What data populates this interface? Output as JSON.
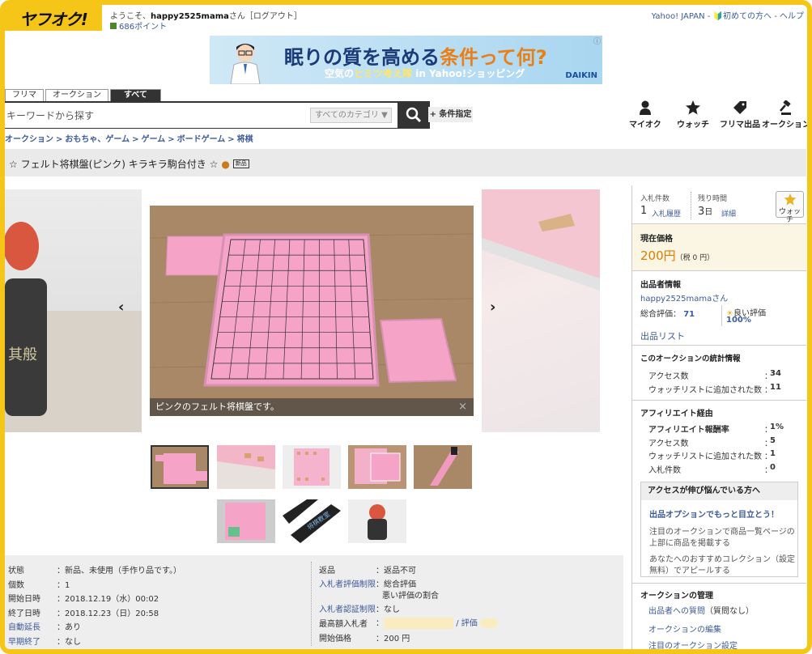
{
  "header": {
    "logo": "ヤフオク!",
    "welcome_prefix": "ようこそ、",
    "username": "happy2525mama",
    "welcome_suffix": "さん［ログアウト］",
    "points": "686ポイント",
    "toplinks": "Yahoo! JAPAN - 🔰初めての方へ - ヘルプ"
  },
  "ad": {
    "line1_a": "眠りの質を高める",
    "line1_b": "条件って何?",
    "line2_a": "空気の",
    "line2_b": "ヒミツ考え隊",
    "line2_c": " in Yahoo!ショッピング",
    "brand": "DAIKIN",
    "info": "ⓘ"
  },
  "search": {
    "tabs": [
      "フリマ",
      "オークション",
      "すべて"
    ],
    "placeholder": "キーワードから探す",
    "category": "すべてのカテゴリ",
    "conditions": "+ 条件指定"
  },
  "nav": {
    "myauc": "マイオク",
    "watch": "ウォッチ",
    "flea_sell": "フリマ出品",
    "auc_sell": "オークション"
  },
  "breadcrumb": [
    "オークション",
    "おもちゃ、ゲーム",
    "ゲーム",
    "ボードゲーム",
    "将棋"
  ],
  "item": {
    "title": "☆ フェルト将棋盤(ピンク) キラキラ駒台付き ☆",
    "badge": "新品",
    "caption": "ピンクのフェルト将棋盤です。",
    "close": "×"
  },
  "details_left": [
    {
      "label": "状態",
      "value": "：新品、未使用（手作り品です。）",
      "link": false
    },
    {
      "label": "個数",
      "value": "：1",
      "link": false
    },
    {
      "label": "開始日時",
      "value": "：2018.12.19（水）00:02",
      "link": false
    },
    {
      "label": "終了日時",
      "value": "：2018.12.23（日）20:58",
      "link": false
    },
    {
      "label": "自動延長",
      "value": "：あり",
      "link": true
    },
    {
      "label": "早期終了",
      "value": "：なし",
      "link": true
    }
  ],
  "details_right": {
    "return_label": "返品",
    "return_value": "：返品不可",
    "rating_label": "入札者評価制限",
    "rating_value1": "：総合評価",
    "rating_value2": "悪い評価の割合",
    "auth_label": "入札者認証制限",
    "auth_value": "：なし",
    "top_label": "最高額入札者",
    "top_sep": "：",
    "top_rating": "/ 評価",
    "start_label": "開始価格",
    "start_value": "：200 円"
  },
  "panel": {
    "bid_count_label": "入札件数",
    "bid_count": "1",
    "bid_history": "入札履歴",
    "remaining_label": "残り時間",
    "remaining_num": "3",
    "remaining_unit": "日",
    "detail": "詳細",
    "watch_btn": "ウォッチ",
    "price_label": "現在価格",
    "price": "200円",
    "price_tax": "（税 0 円）",
    "seller_label": "出品者情報",
    "seller_name": "happy2525mama",
    "seller_suffix": "さん",
    "total_rating_label": "総合評価：",
    "total_rating": "71",
    "good_rating_label": "良い評価",
    "good_rating": "100%",
    "listing": "出品リスト",
    "stats_title": "このオークションの統計情報",
    "stats": [
      {
        "label": "アクセス数",
        "value": "34"
      },
      {
        "label": "ウォッチリストに追加された数",
        "value": "11"
      }
    ],
    "affiliate_title": "アフィリエイト経由",
    "affiliate": [
      {
        "label": "アフィリエイト報酬率",
        "value": "1%"
      },
      {
        "label": "アクセス数",
        "value": "5"
      },
      {
        "label": "ウォッチリストに追加された数",
        "value": "1"
      },
      {
        "label": "入札件数",
        "value": "0"
      }
    ],
    "tip_title": "アクセスが伸び悩んでいる方へ",
    "tip_link": "出品オプションでもっと目立とう！",
    "tip_text1a": "注目のオークションで商品一覧ページの",
    "tip_text1b": "上部に商品を掲載する",
    "tip_text2a": "あなたへのおすすめコレクション（設定",
    "tip_text2b": "無料）でアピールする",
    "manage_title": "オークションの管理",
    "manage_q": "出品者への質問",
    "manage_q_suffix": "（質問なし）",
    "manage_edit": "オークションの編集",
    "manage_featured": "注目のオークション設定"
  }
}
